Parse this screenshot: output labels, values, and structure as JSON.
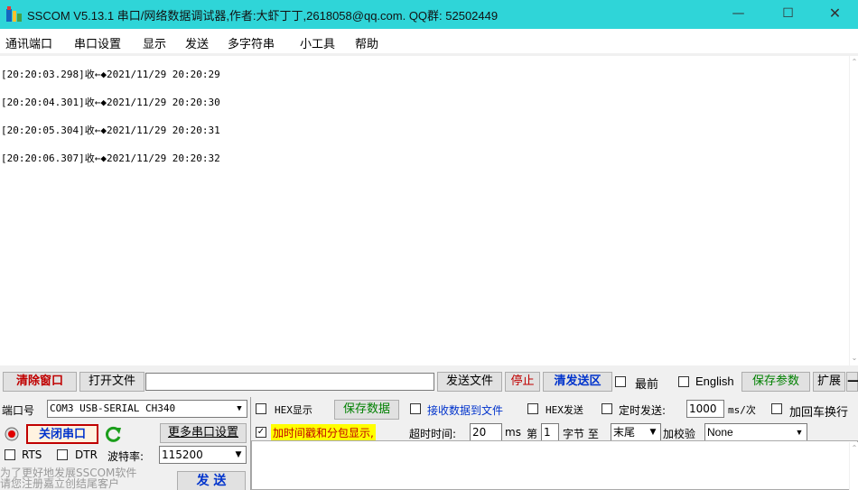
{
  "window": {
    "title": "SSCOM V5.13.1 串口/网络数据调试器,作者:大虾丁丁,2618058@qq.com. QQ群: 52502449",
    "minimize_glyph": "—",
    "maximize_glyph": "☐",
    "close_glyph": "✕"
  },
  "menu": [
    "通讯端口",
    "串口设置",
    "显示",
    "发送",
    "多字符串",
    "小工具",
    "帮助"
  ],
  "receive": {
    "lines": [
      "[20:20:03.298]收←◆2021/11/29 20:20:29",
      "[20:20:04.301]收←◆2021/11/29 20:20:30",
      "[20:20:05.304]收←◆2021/11/29 20:20:31",
      "[20:20:06.307]收←◆2021/11/29 20:20:32"
    ]
  },
  "toolbar1": {
    "clear_window": "清除窗口",
    "open_file": "打开文件",
    "file_path": "",
    "send_file": "发送文件",
    "stop": "停止",
    "clear_send": "清发送区",
    "topmost_label": "最前",
    "topmost_checked": false,
    "english_label": "English",
    "english_checked": false,
    "save_params": "保存参数",
    "expand": "扩展",
    "collapse": "—"
  },
  "toolbar2": {
    "port_label": "端口号",
    "port_value": "COM3 USB-SERIAL CH340",
    "hex_display_label": "HEX显示",
    "hex_display_checked": false,
    "save_data": "保存数据",
    "recv_to_file_label": "接收数据到文件",
    "recv_to_file_checked": false,
    "hex_send_label": "HEX发送",
    "hex_send_checked": false,
    "timed_send_label": "定时发送:",
    "timed_send_checked": false,
    "interval_value": "1000",
    "interval_unit": "ms/次",
    "append_newline_label": "加回车换行",
    "append_newline_checked": false
  },
  "toolbar3": {
    "close_port": "关闭串口",
    "more_settings": "更多串口设置",
    "timestamp_label": "加时间戳和分包显示,",
    "timestamp_checked": true,
    "timeout_label": "超时时间:",
    "timeout_value": "20",
    "timeout_unit": "ms",
    "nth_label": "第",
    "nth_value": "1",
    "byte_to_label": "字节 至",
    "end_value": "末尾",
    "checksum_label": "加校验",
    "checksum_value": "None"
  },
  "toolbar4": {
    "rts_label": "RTS",
    "rts_checked": false,
    "dtr_label": "DTR",
    "dtr_checked": false,
    "baud_label": "波特率:",
    "baud_value": "115200"
  },
  "promo": {
    "line1": "为了更好地发展SSCOM软件",
    "line2": "请您注册嘉立创结尾客户"
  },
  "send": {
    "button": "发 送",
    "text": ""
  },
  "colors": {
    "titlebar": "#2fd5d8",
    "accent_red": "#c00000",
    "accent_green": "#008000",
    "accent_blue": "#0033cc",
    "highlight_yellow": "#ffff00"
  }
}
